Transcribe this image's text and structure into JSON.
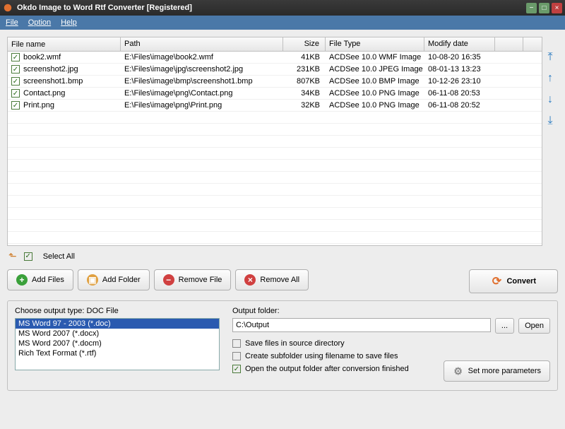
{
  "title": "Okdo Image to Word Rtf Converter [Registered]",
  "menu": {
    "file": "File",
    "option": "Option",
    "help": "Help"
  },
  "columns": {
    "name": "File name",
    "path": "Path",
    "size": "Size",
    "type": "File Type",
    "date": "Modify date"
  },
  "rows": [
    {
      "name": "book2.wmf",
      "path": "E:\\Files\\image\\book2.wmf",
      "size": "41KB",
      "type": "ACDSee 10.0 WMF Image",
      "date": "10-08-20 16:35"
    },
    {
      "name": "screenshot2.jpg",
      "path": "E:\\Files\\image\\jpg\\screenshot2.jpg",
      "size": "231KB",
      "type": "ACDSee 10.0 JPEG Image",
      "date": "08-01-13 13:23"
    },
    {
      "name": "screenshot1.bmp",
      "path": "E:\\Files\\image\\bmp\\screenshot1.bmp",
      "size": "807KB",
      "type": "ACDSee 10.0 BMP Image",
      "date": "10-12-26 23:10"
    },
    {
      "name": "Contact.png",
      "path": "E:\\Files\\image\\png\\Contact.png",
      "size": "34KB",
      "type": "ACDSee 10.0 PNG Image",
      "date": "06-11-08 20:53"
    },
    {
      "name": "Print.png",
      "path": "E:\\Files\\image\\png\\Print.png",
      "size": "32KB",
      "type": "ACDSee 10.0 PNG Image",
      "date": "06-11-08 20:52"
    }
  ],
  "select_all": "Select All",
  "buttons": {
    "add_files": "Add Files",
    "add_folder": "Add Folder",
    "remove_file": "Remove File",
    "remove_all": "Remove All",
    "convert": "Convert"
  },
  "output_type": {
    "label": "Choose output type:  DOC File",
    "options": [
      "MS Word 97 - 2003 (*.doc)",
      "MS Word 2007 (*.docx)",
      "MS Word 2007 (*.docm)",
      "Rich Text Format (*.rtf)"
    ]
  },
  "output_folder": {
    "label": "Output folder:",
    "value": "C:\\Output",
    "browse": "...",
    "open": "Open"
  },
  "checks": {
    "save_source": "Save files in source directory",
    "subfolder": "Create subfolder using filename to save files",
    "open_after": "Open the output folder after conversion finished"
  },
  "more_params": "Set more parameters"
}
